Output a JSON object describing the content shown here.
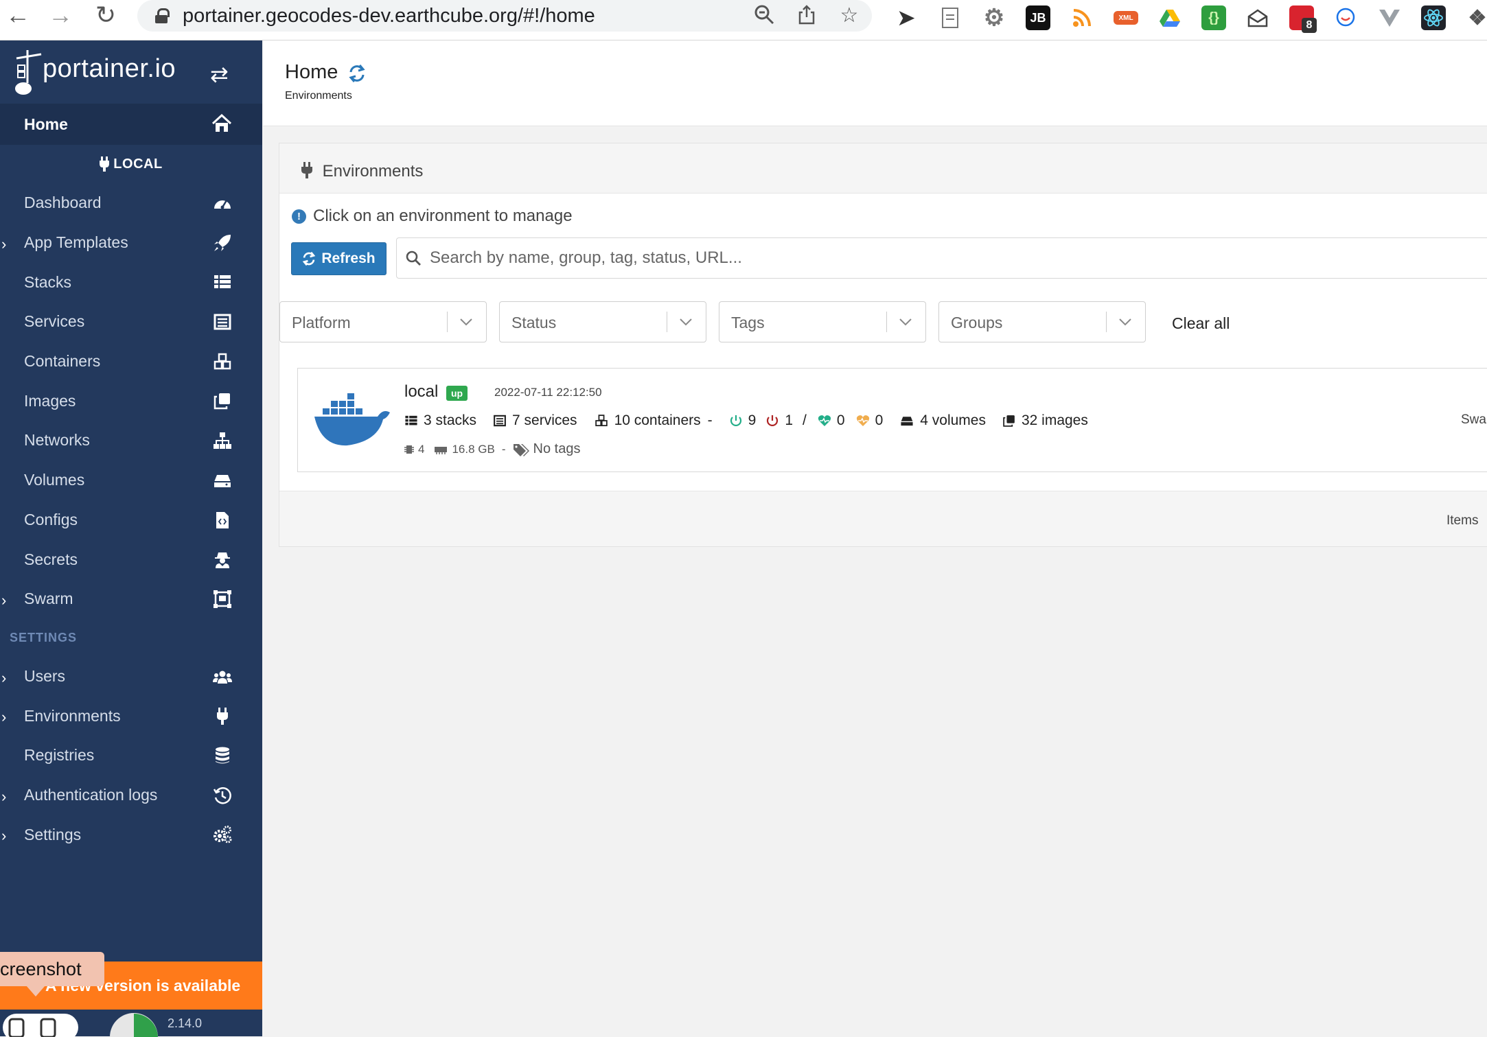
{
  "browser": {
    "url": "portainer.geocodes-dev.earthcube.org/#!/home",
    "extensions": [
      "rocket-extension-icon",
      "document-extension-icon",
      "gear-extension-icon",
      "jb-extension-icon",
      "rss-extension-icon",
      "xml-extension-icon",
      "drive-extension-icon",
      "json-extension-icon",
      "mail-extension-icon",
      "notification-extension-icon",
      "chat-extension-icon",
      "vue-extension-icon",
      "react-extension-icon"
    ],
    "ext_labels": {
      "jb": "JB",
      "xml": "XML",
      "json": "{}",
      "badge": "8"
    }
  },
  "sidebar": {
    "brand": "portainer.io",
    "home": {
      "label": "Home",
      "icon": "home-icon"
    },
    "env_header": "LOCAL",
    "items": [
      {
        "label": "Dashboard",
        "icon": "tachometer-icon",
        "chevron": false
      },
      {
        "label": "App Templates",
        "icon": "rocket-icon",
        "chevron": true
      },
      {
        "label": "Stacks",
        "icon": "list-icon",
        "chevron": false
      },
      {
        "label": "Services",
        "icon": "services-list-icon",
        "chevron": false
      },
      {
        "label": "Containers",
        "icon": "cubes-icon",
        "chevron": false
      },
      {
        "label": "Images",
        "icon": "clone-icon",
        "chevron": false
      },
      {
        "label": "Networks",
        "icon": "sitemap-icon",
        "chevron": false
      },
      {
        "label": "Volumes",
        "icon": "hdd-icon",
        "chevron": false
      },
      {
        "label": "Configs",
        "icon": "file-code-icon",
        "chevron": false
      },
      {
        "label": "Secrets",
        "icon": "user-secret-icon",
        "chevron": false
      },
      {
        "label": "Swarm",
        "icon": "object-group-icon",
        "chevron": true
      }
    ],
    "settings_title": "SETTINGS",
    "settings_items": [
      {
        "label": "Users",
        "icon": "users-icon",
        "chevron": true
      },
      {
        "label": "Environments",
        "icon": "plug-icon",
        "chevron": true
      },
      {
        "label": "Registries",
        "icon": "database-icon",
        "chevron": false
      },
      {
        "label": "Authentication logs",
        "icon": "history-icon",
        "chevron": true
      },
      {
        "label": "Settings",
        "icon": "cogs-icon",
        "chevron": true
      }
    ],
    "update_banner": "A new version is available",
    "version": "2.14.0",
    "tooltip": "creenshot"
  },
  "header": {
    "title": "Home",
    "subtitle": "Environments"
  },
  "environments": {
    "title": "Environments",
    "hint": "Click on an environment to manage",
    "refresh_label": "Refresh",
    "search_placeholder": "Search by name, group, tag, status, URL...",
    "filters": [
      "Platform",
      "Status",
      "Tags",
      "Groups"
    ],
    "clear_all": "Clear all",
    "items_label": "Items",
    "endpoint": {
      "name": "local",
      "status": "up",
      "timestamp": "2022-07-11 22:12:50",
      "stacks": "3 stacks",
      "services": "7 services",
      "containers": "10 containers",
      "running": "9",
      "stopped": "1",
      "healthy": "0",
      "unhealthy": "0",
      "volumes": "4 volumes",
      "images": "32 images",
      "cpu": "4",
      "memory": "16.8 GB",
      "tags": "No tags",
      "type": "Swarm"
    }
  },
  "colors": {
    "sidebar_bg": "#23395d",
    "accent_blue": "#2a79b9",
    "update_orange": "#ff7a1a",
    "status_green": "#2fa84f",
    "running_green": "#23ae89",
    "stopped_red": "#ae2323",
    "unhealthy_orange": "#f0ad4e"
  }
}
